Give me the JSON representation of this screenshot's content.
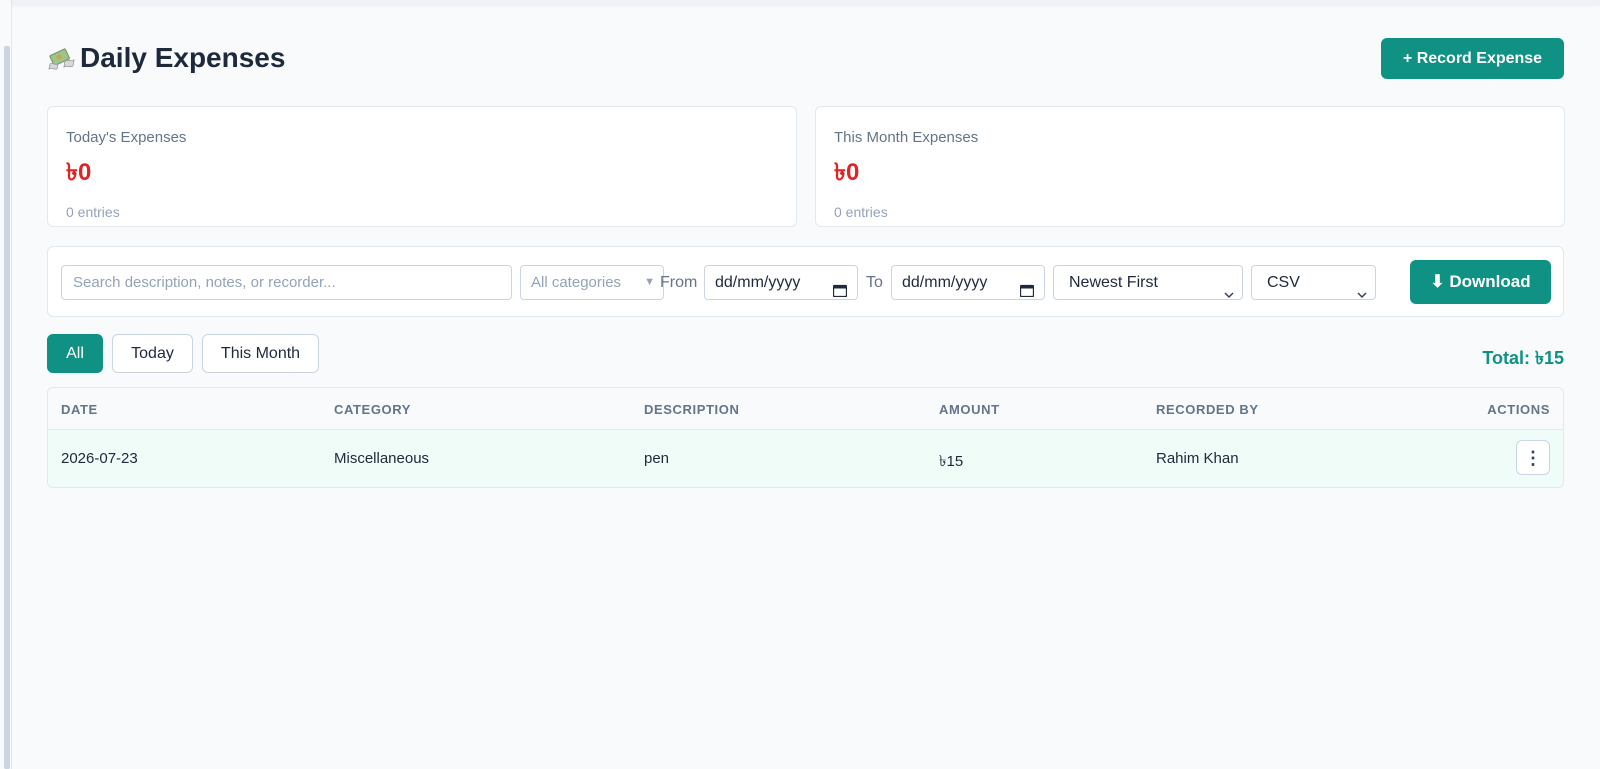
{
  "header": {
    "title": "Daily Expenses",
    "record_button": "+ Record Expense"
  },
  "cards": {
    "today": {
      "label": "Today's Expenses",
      "value": "৳0",
      "sub": "0 entries"
    },
    "month": {
      "label": "This Month Expenses",
      "value": "৳0",
      "sub": "0 entries"
    }
  },
  "filters": {
    "search_placeholder": "Search description, notes, or recorder...",
    "category": "All categories",
    "from_label": "From",
    "from_value": "dd/mm/yyyy",
    "to_label": "To",
    "to_value": "dd/mm/yyyy",
    "sort": "Newest First",
    "format": "CSV",
    "download": "⬇ Download"
  },
  "tabs": [
    "All",
    "Today",
    "This Month"
  ],
  "total": "Total: ৳15",
  "table": {
    "columns": [
      "DATE",
      "CATEGORY",
      "DESCRIPTION",
      "AMOUNT",
      "RECORDED BY",
      "ACTIONS"
    ],
    "rows": [
      {
        "date": "2026-07-23",
        "category": "Miscellaneous",
        "description": "pen",
        "amount": "৳15",
        "recorded_by": "Rahim Khan",
        "actions": "⋮"
      }
    ]
  },
  "colors": {
    "accent": "#0f9183",
    "expense_value": "#dc2626",
    "row_highlight": "#effcf8"
  },
  "icons": {
    "title_icon": "money-with-wings-icon",
    "calendar": "calendar-icon",
    "actions": "more-vertical-icon"
  }
}
